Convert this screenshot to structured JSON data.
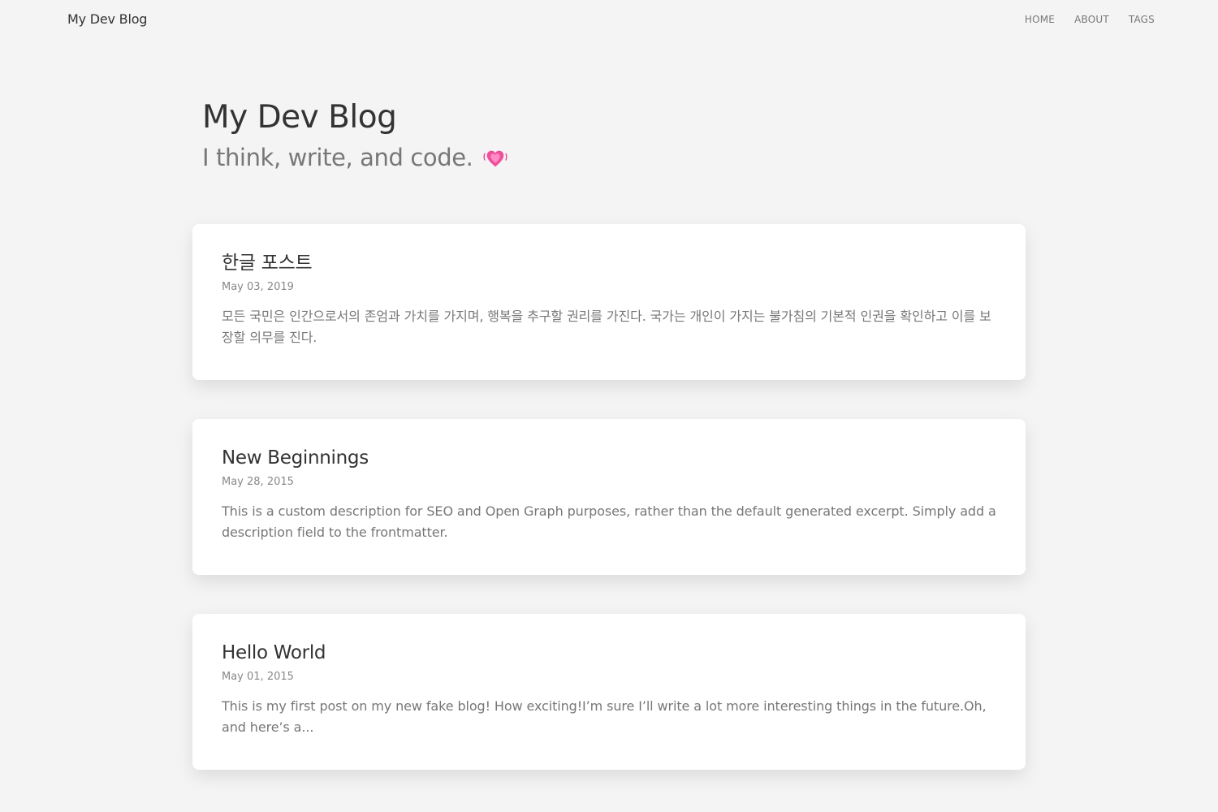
{
  "header": {
    "brand": "My Dev Blog",
    "nav": [
      "HOME",
      "ABOUT",
      "TAGS"
    ]
  },
  "hero": {
    "title": "My Dev Blog",
    "subtitle": "I think, write, and code.",
    "subtitle_icon": "heart-icon"
  },
  "posts": [
    {
      "title": "한글 포스트",
      "date": "May 03, 2019",
      "excerpt": "모든 국민은 인간으로서의 존엄과 가치를 가지며, 행복을 추구할 권리를 가진다. 국가는 개인이 가지는 불가침의 기본적 인권을 확인하고 이를 보장할 의무를 진다."
    },
    {
      "title": "New Beginnings",
      "date": "May 28, 2015",
      "excerpt": "This is a custom description for SEO and Open Graph purposes, rather than the default generated excerpt. Simply add a description field to the frontmatter."
    },
    {
      "title": "Hello World",
      "date": "May 01, 2015",
      "excerpt": "This is my first post on my new fake blog! How exciting!I’m sure I’ll write a lot more interesting things in the future.Oh, and here’s a..."
    }
  ],
  "colors": {
    "background": "#f4f4f4",
    "card": "#ffffff",
    "text": "#333333",
    "muted": "#777777",
    "heart": "#f0509b"
  }
}
